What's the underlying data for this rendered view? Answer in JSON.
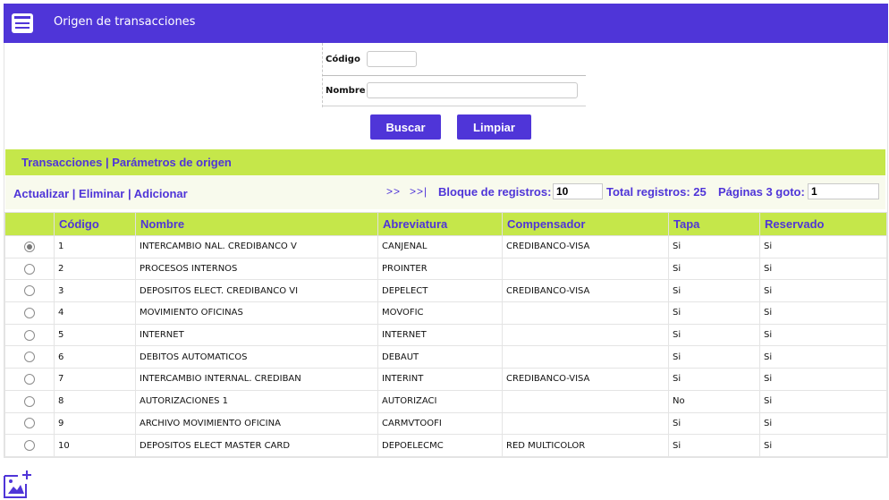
{
  "header": {
    "title": "Origen de transacciones",
    "icon": "list-window-icon",
    "color": "#4f35d8"
  },
  "form": {
    "codigo_label": "Código",
    "codigo_value": "",
    "nombre_label": "Nombre",
    "nombre_value": ""
  },
  "buttons": {
    "buscar": "Buscar",
    "limpiar": "Limpiar"
  },
  "links": {
    "transacciones": "Transacciones",
    "parametros": "Parámetros de origen",
    "separator": "|"
  },
  "actions": {
    "actualizar": "Actualizar",
    "eliminar": "Eliminar",
    "adicionar": "Adicionar",
    "separator": "|"
  },
  "pager": {
    "next": ">>",
    "last": ">>|",
    "bloque_label": "Bloque de registros:",
    "bloque_value": "10",
    "total_label": "Total registros: 25",
    "paginas_label": "Páginas 3 goto:",
    "goto_value": "1"
  },
  "accent_green": "#c5e74a",
  "table": {
    "columns": [
      "Código",
      "Nombre",
      "Abreviatura",
      "Compensador",
      "Tapa",
      "Reservado"
    ],
    "rows": [
      {
        "selected": true,
        "codigo": "1",
        "nombre": "INTERCAMBIO NAL. CREDIBANCO V",
        "abreviatura": "CANJENAL",
        "compensador": "CREDIBANCO-VISA",
        "tapa": "Si",
        "reservado": "Si"
      },
      {
        "selected": false,
        "codigo": "2",
        "nombre": "PROCESOS INTERNOS",
        "abreviatura": "PROINTER",
        "compensador": "",
        "tapa": "Si",
        "reservado": "Si"
      },
      {
        "selected": false,
        "codigo": "3",
        "nombre": "DEPOSITOS ELECT. CREDIBANCO VI",
        "abreviatura": "DEPELECT",
        "compensador": "CREDIBANCO-VISA",
        "tapa": "Si",
        "reservado": "Si"
      },
      {
        "selected": false,
        "codigo": "4",
        "nombre": "MOVIMIENTO OFICINAS",
        "abreviatura": "MOVOFIC",
        "compensador": "",
        "tapa": "Si",
        "reservado": "Si"
      },
      {
        "selected": false,
        "codigo": "5",
        "nombre": "INTERNET",
        "abreviatura": "INTERNET",
        "compensador": "",
        "tapa": "Si",
        "reservado": "Si"
      },
      {
        "selected": false,
        "codigo": "6",
        "nombre": "DEBITOS AUTOMATICOS",
        "abreviatura": "DEBAUT",
        "compensador": "",
        "tapa": "Si",
        "reservado": "Si"
      },
      {
        "selected": false,
        "codigo": "7",
        "nombre": "INTERCAMBIO INTERNAL. CREDIBAN",
        "abreviatura": "INTERINT",
        "compensador": "CREDIBANCO-VISA",
        "tapa": "Si",
        "reservado": "Si"
      },
      {
        "selected": false,
        "codigo": "8",
        "nombre": "AUTORIZACIONES 1",
        "abreviatura": "AUTORIZACI",
        "compensador": "",
        "tapa": "No",
        "reservado": "Si"
      },
      {
        "selected": false,
        "codigo": "9",
        "nombre": "ARCHIVO MOVIMIENTO OFICINA",
        "abreviatura": "CARMVTOOFI",
        "compensador": "",
        "tapa": "Si",
        "reservado": "Si"
      },
      {
        "selected": false,
        "codigo": "10",
        "nombre": "DEPOSITOS ELECT MASTER CARD",
        "abreviatura": "DEPOELECMC",
        "compensador": "RED MULTICOLOR",
        "tapa": "Si",
        "reservado": "Si"
      }
    ]
  },
  "footer": {
    "icon": "add-image-icon"
  }
}
